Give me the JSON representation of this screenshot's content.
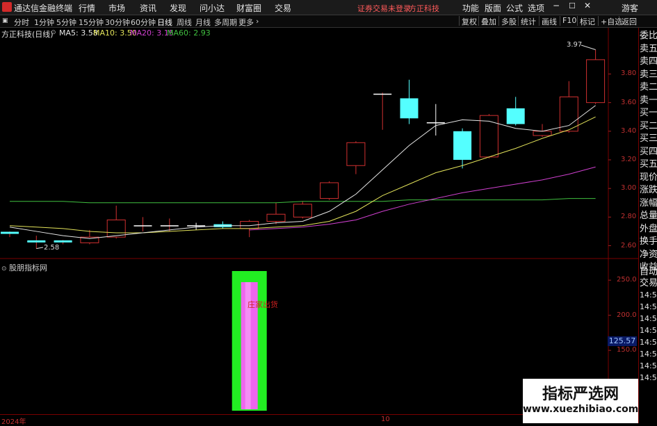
{
  "app": {
    "title": "通达信金融终端",
    "menu": [
      "行情",
      "市场",
      "资讯",
      "发现",
      "问小达",
      "财富圈",
      "交易"
    ],
    "login_status": "证券交易未登录",
    "broker": "方正科技",
    "right_menu": [
      "功能",
      "版面",
      "公式",
      "选项"
    ],
    "guest": "游客"
  },
  "toolbar": {
    "timeframes": [
      "分时",
      "1分钟",
      "5分钟",
      "15分钟",
      "30分钟",
      "60分钟",
      "日线",
      "周线",
      "月线",
      "多周期",
      "更多"
    ],
    "active": "日线",
    "buttons": [
      "复权",
      "叠加",
      "多股",
      "统计",
      "画线",
      "F10",
      "标记",
      "+自选",
      "返回"
    ]
  },
  "chart": {
    "stock_label": "方正科技(日线)",
    "ma": [
      {
        "label": "MA5: 3.58",
        "color": "#e6e6e6"
      },
      {
        "label": "MA10: 3.50",
        "color": "#e3e35a"
      },
      {
        "label": "MA20: 3.15",
        "color": "#d040d0"
      },
      {
        "label": "MA60: 2.93",
        "color": "#40c040"
      }
    ],
    "high_label": "3.97",
    "low_label": "2.58"
  },
  "chart_data": {
    "type": "candlestick",
    "yticks": [
      "3.80",
      "3.60",
      "3.40",
      "3.20",
      "3.00",
      "2.80",
      "2.60"
    ],
    "ylim": [
      2.52,
      4.05
    ],
    "candles": [
      {
        "o": 2.68,
        "c": 2.69,
        "h": 2.7,
        "l": 2.66
      },
      {
        "o": 2.63,
        "c": 2.63,
        "h": 2.67,
        "l": 2.58
      },
      {
        "o": 2.62,
        "c": 2.63,
        "h": 2.64,
        "l": 2.61
      },
      {
        "o": 2.62,
        "c": 2.66,
        "h": 2.71,
        "l": 2.61
      },
      {
        "o": 2.66,
        "c": 2.78,
        "h": 2.88,
        "l": 2.65
      },
      {
        "o": 2.74,
        "c": 2.74,
        "h": 2.8,
        "l": 2.7
      },
      {
        "o": 2.74,
        "c": 2.74,
        "h": 2.79,
        "l": 2.7
      },
      {
        "o": 2.74,
        "c": 2.73,
        "h": 2.76,
        "l": 2.71
      },
      {
        "o": 2.75,
        "c": 2.73,
        "h": 2.77,
        "l": 2.72
      },
      {
        "o": 2.72,
        "c": 2.77,
        "h": 2.78,
        "l": 2.66
      },
      {
        "o": 2.77,
        "c": 2.82,
        "h": 2.9,
        "l": 2.75
      },
      {
        "o": 2.8,
        "c": 2.89,
        "h": 2.91,
        "l": 2.79
      },
      {
        "o": 2.93,
        "c": 3.04,
        "h": 3.05,
        "l": 2.92
      },
      {
        "o": 3.16,
        "c": 3.32,
        "h": 3.33,
        "l": 3.1
      },
      {
        "o": 3.66,
        "c": 3.66,
        "h": 3.67,
        "l": 3.41
      },
      {
        "o": 3.63,
        "c": 3.49,
        "h": 3.76,
        "l": 3.45
      },
      {
        "o": 3.46,
        "c": 3.45,
        "h": 3.59,
        "l": 3.37
      },
      {
        "o": 3.4,
        "c": 3.2,
        "h": 3.42,
        "l": 3.14
      },
      {
        "o": 3.22,
        "c": 3.51,
        "h": 3.52,
        "l": 3.21
      },
      {
        "o": 3.56,
        "c": 3.45,
        "h": 3.64,
        "l": 3.44
      },
      {
        "o": 3.37,
        "c": 3.4,
        "h": 3.45,
        "l": 3.36
      },
      {
        "o": 3.4,
        "c": 3.64,
        "h": 3.75,
        "l": 3.39
      },
      {
        "o": 3.6,
        "c": 3.9,
        "h": 3.97,
        "l": 3.59
      }
    ],
    "ma5": [
      2.73,
      2.7,
      2.67,
      2.65,
      2.67,
      2.69,
      2.71,
      2.73,
      2.74,
      2.74,
      2.76,
      2.77,
      2.84,
      2.96,
      3.13,
      3.3,
      3.44,
      3.48,
      3.47,
      3.42,
      3.4,
      3.44,
      3.58
    ],
    "ma10": [
      2.74,
      2.73,
      2.72,
      2.7,
      2.69,
      2.69,
      2.7,
      2.71,
      2.72,
      2.72,
      2.73,
      2.74,
      2.77,
      2.84,
      2.95,
      3.03,
      3.11,
      3.16,
      3.22,
      3.28,
      3.35,
      3.41,
      3.5
    ],
    "ma20": [
      null,
      null,
      null,
      null,
      null,
      null,
      null,
      null,
      null,
      2.71,
      2.72,
      2.73,
      2.75,
      2.78,
      2.84,
      2.89,
      2.93,
      2.97,
      3.0,
      3.03,
      3.06,
      3.1,
      3.15
    ],
    "ma60": [
      2.91,
      2.91,
      2.91,
      2.9,
      2.9,
      2.9,
      2.9,
      2.9,
      2.9,
      2.9,
      2.9,
      2.91,
      2.91,
      2.91,
      2.91,
      2.92,
      2.92,
      2.92,
      2.92,
      2.92,
      2.92,
      2.93,
      2.93
    ]
  },
  "sub": {
    "title": "股朋指标网",
    "yticks": [
      "250.0",
      "200.0",
      "150.0",
      "100.0"
    ],
    "ylim": [
      60,
      265
    ],
    "price_box": "125.57",
    "annotation": "庄家出货",
    "bar_value": 250
  },
  "xaxis": {
    "labels": [
      "2024年",
      "10"
    ]
  },
  "side": {
    "labels": [
      "委比",
      "卖五",
      "卖四",
      "卖三",
      "卖二",
      "卖一",
      "买一",
      "买二",
      "买三",
      "买四",
      "买五",
      "现价",
      "涨跌",
      "涨幅",
      "总量",
      "外盘",
      "换手",
      "净资",
      "收益",
      "自动",
      "交易"
    ],
    "times": [
      "14:56",
      "14:56",
      "14:56",
      "14:56",
      "14:56",
      "14:56",
      "14:56",
      "14:56"
    ]
  },
  "watermark": {
    "title": "指标严选网",
    "url": "www.xuezhibiao.com"
  },
  "colors": {
    "up": "#d03030",
    "down": "#54ffff",
    "ma5": "#e6e6e6",
    "ma10": "#e3e35a",
    "ma20": "#d040d0",
    "ma60": "#40c040",
    "bar_outer": "#22ee22",
    "bar_inner": "#ee66ee"
  }
}
